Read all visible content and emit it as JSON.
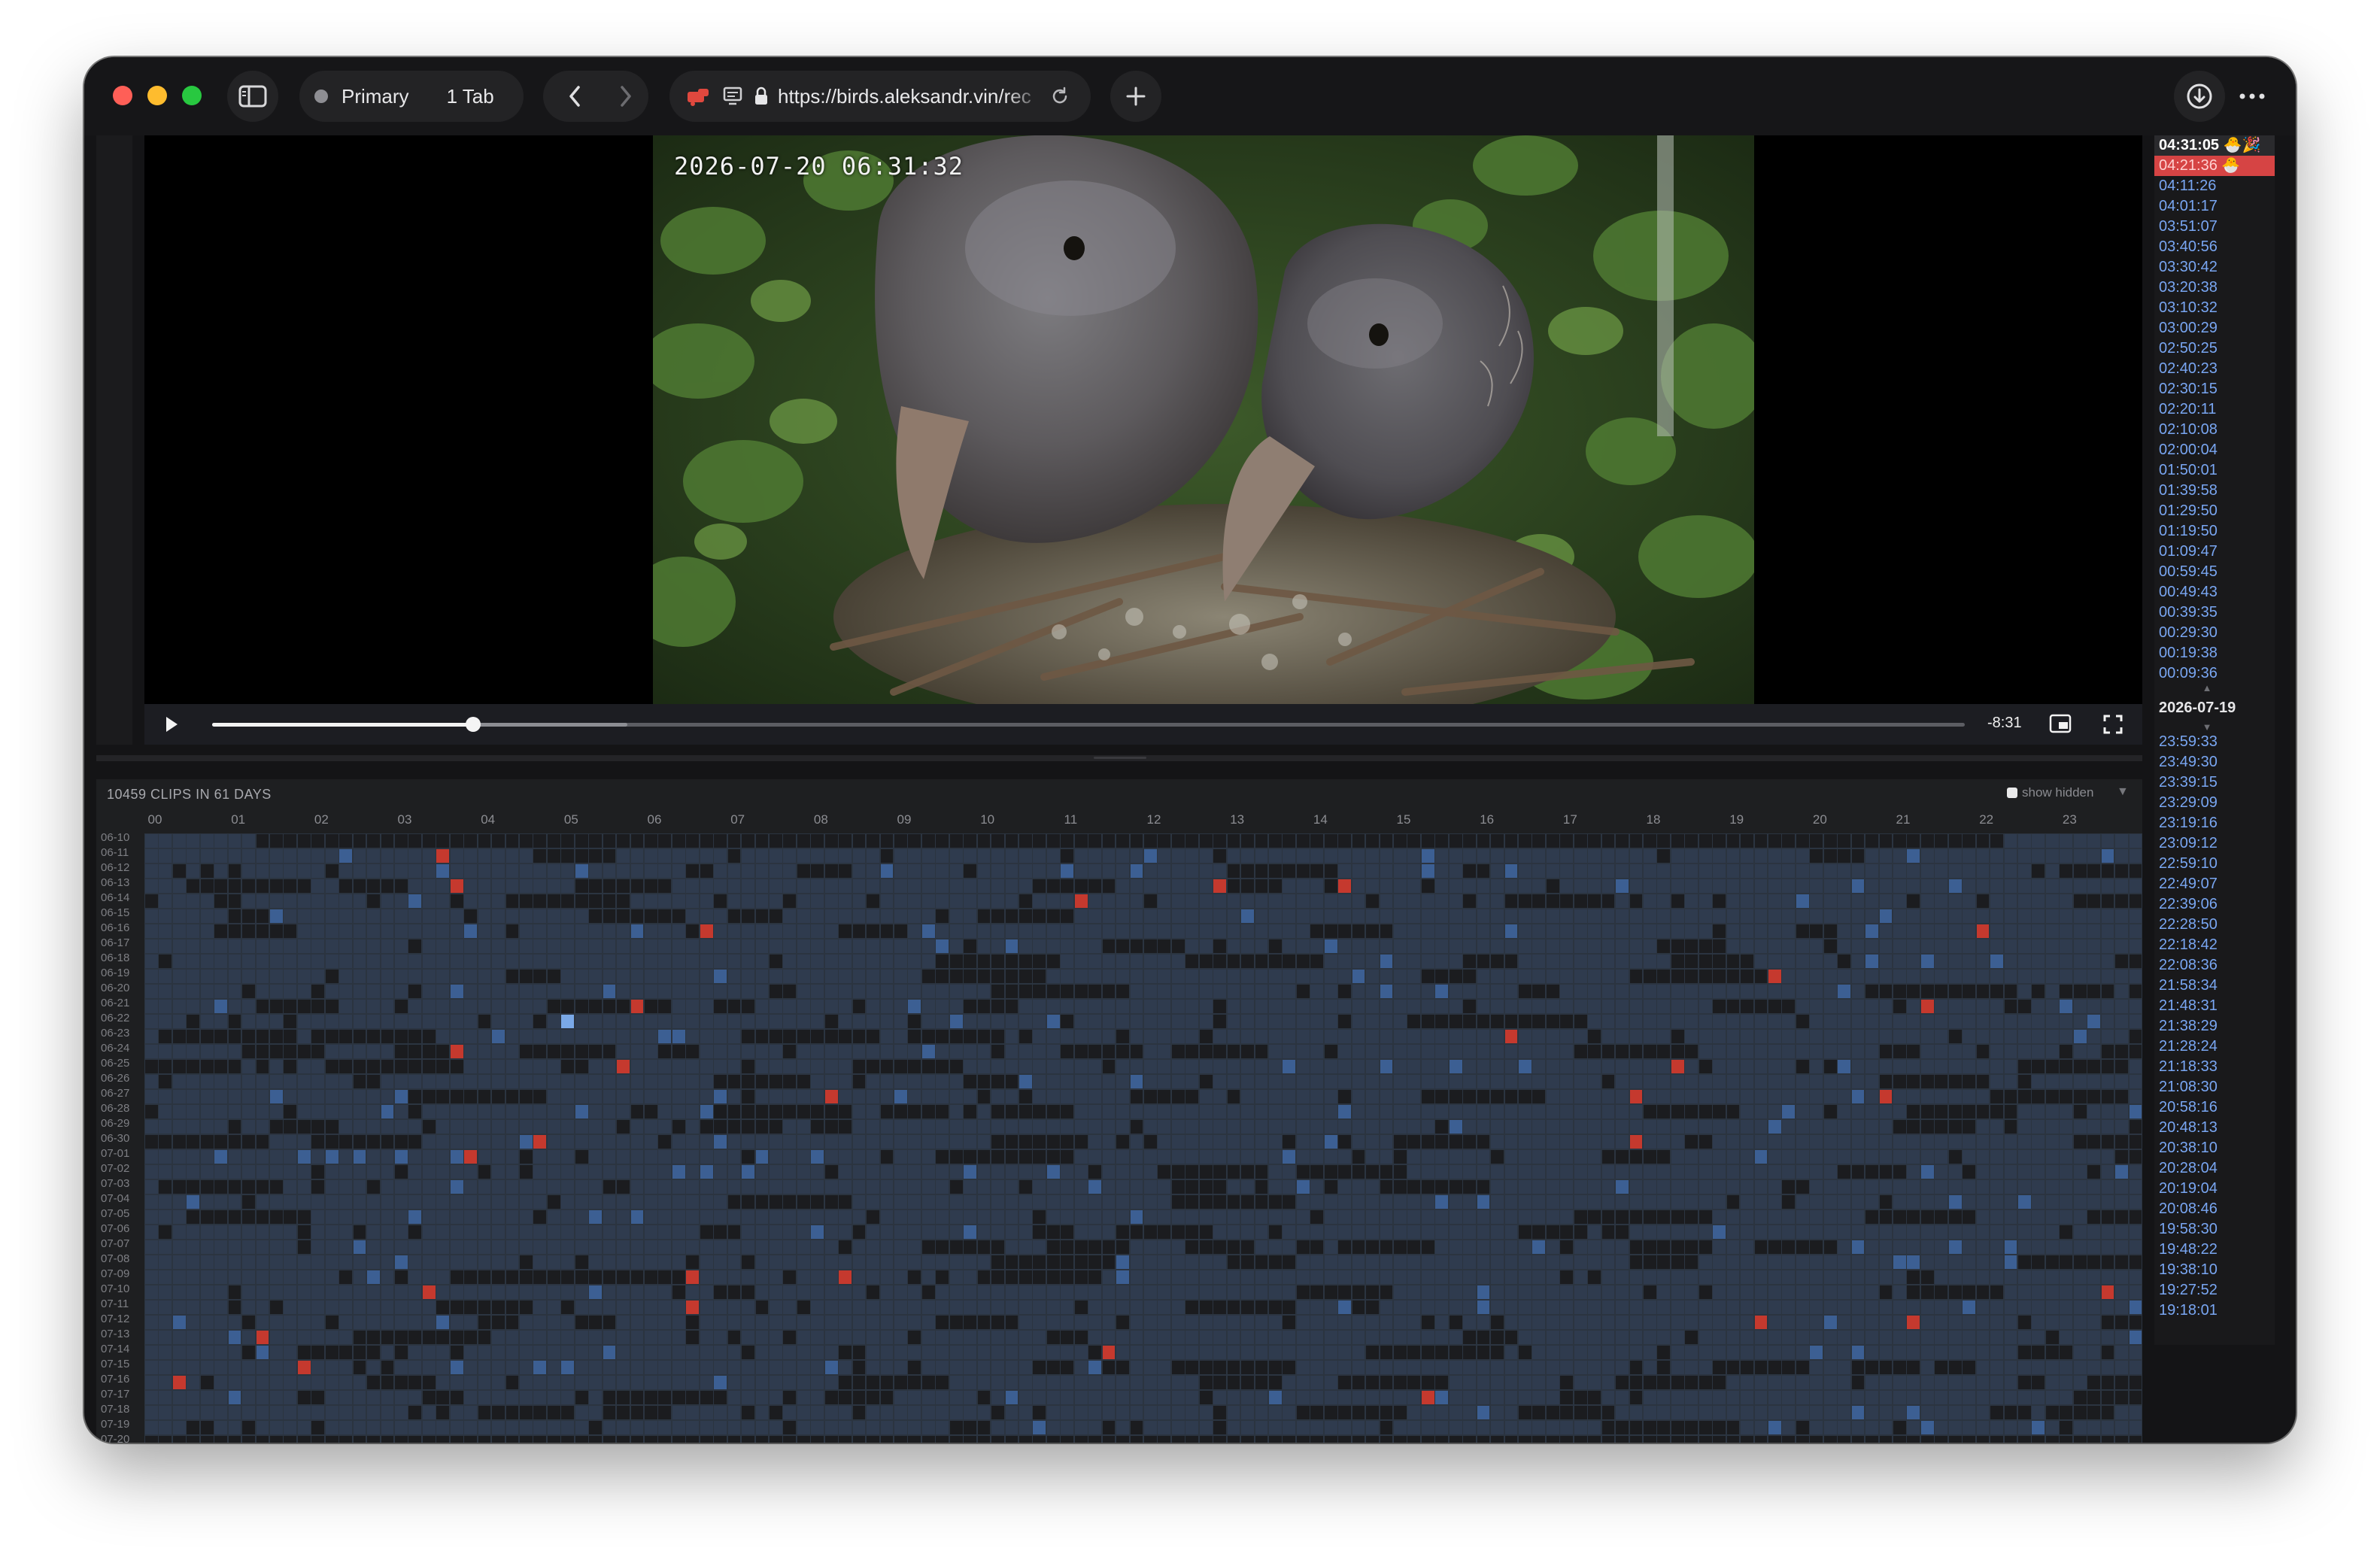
{
  "browser": {
    "profile": "Primary",
    "tab_count": "1 Tab",
    "url": "https://birds.aleksandr.vin/rec"
  },
  "video": {
    "timestamp": "2026-07-20 06:31:32",
    "time_remaining": "-8:31",
    "progress_fraction": 0.149,
    "buffered_fraction": 0.237
  },
  "heatmap": {
    "summary": "10459 CLIPS IN 61 DAYS",
    "show_hidden_label": "show hidden",
    "caret": "▼",
    "hours": [
      "00",
      "01",
      "02",
      "03",
      "04",
      "05",
      "06",
      "07",
      "08",
      "09",
      "10",
      "11",
      "12",
      "13",
      "14",
      "15",
      "16",
      "17",
      "18",
      "19",
      "20",
      "21",
      "22",
      "23"
    ],
    "dates": [
      "06-10",
      "06-11",
      "06-12",
      "06-13",
      "06-14",
      "06-15",
      "06-16",
      "06-17",
      "06-18",
      "06-19",
      "06-20",
      "06-21",
      "06-22",
      "06-23",
      "06-24",
      "06-25",
      "06-26",
      "06-27",
      "06-28",
      "06-29",
      "06-30",
      "07-01",
      "07-02",
      "07-03",
      "07-04",
      "07-05",
      "07-06",
      "07-07",
      "07-08",
      "07-09",
      "07-10",
      "07-11",
      "07-12",
      "07-13",
      "07-14",
      "07-15",
      "07-16",
      "07-17",
      "07-18",
      "07-19",
      "07-20"
    ],
    "colors": {
      "normal": "#2f3b4e",
      "empty": "#1b1c1f",
      "highlight": "#3c5f93",
      "bright": "#7aa8e6",
      "alert": "#c5392e"
    }
  },
  "timeline": {
    "today": [
      {
        "time": "04:31:05",
        "icons": "🐣🎉",
        "state": "selected"
      },
      {
        "time": "04:21:36",
        "icons": "🐣",
        "state": "highlight"
      },
      {
        "time": "04:11:26"
      },
      {
        "time": "04:01:17"
      },
      {
        "time": "03:51:07"
      },
      {
        "time": "03:40:56"
      },
      {
        "time": "03:30:42"
      },
      {
        "time": "03:20:38"
      },
      {
        "time": "03:10:32"
      },
      {
        "time": "03:00:29"
      },
      {
        "time": "02:50:25"
      },
      {
        "time": "02:40:23"
      },
      {
        "time": "02:30:15"
      },
      {
        "time": "02:20:11"
      },
      {
        "time": "02:10:08"
      },
      {
        "time": "02:00:04"
      },
      {
        "time": "01:50:01"
      },
      {
        "time": "01:39:58"
      },
      {
        "time": "01:29:50"
      },
      {
        "time": "01:19:50"
      },
      {
        "time": "01:09:47"
      },
      {
        "time": "00:59:45"
      },
      {
        "time": "00:49:43"
      },
      {
        "time": "00:39:35"
      },
      {
        "time": "00:29:30"
      },
      {
        "time": "00:19:38"
      },
      {
        "time": "00:09:36"
      }
    ],
    "date_header": "2026-07-19",
    "previous": [
      "23:59:33",
      "23:49:30",
      "23:39:15",
      "23:29:09",
      "23:19:16",
      "23:09:12",
      "22:59:10",
      "22:49:07",
      "22:39:06",
      "22:28:50",
      "22:18:42",
      "22:08:36",
      "21:58:34",
      "21:48:31",
      "21:38:29",
      "21:28:24",
      "21:18:33",
      "21:08:30",
      "20:58:16",
      "20:48:13",
      "20:38:10",
      "20:28:04",
      "20:19:04",
      "20:08:46",
      "19:58:30",
      "19:48:22",
      "19:38:10",
      "19:27:52",
      "19:18:01"
    ]
  }
}
